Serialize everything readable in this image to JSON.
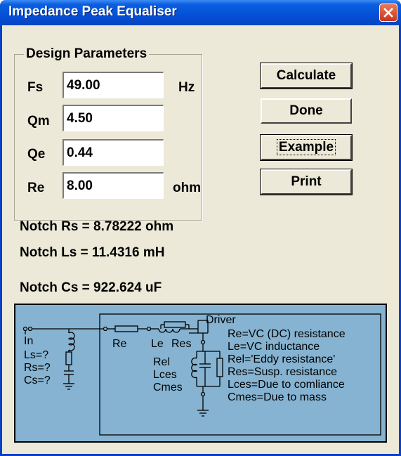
{
  "window": {
    "title": "Impedance Peak Equaliser"
  },
  "design": {
    "legend": "Design Parameters",
    "fs": {
      "label": "Fs",
      "value": "49.00",
      "unit": "Hz"
    },
    "qm": {
      "label": "Qm",
      "value": "4.50"
    },
    "qe": {
      "label": "Qe",
      "value": "0.44"
    },
    "re": {
      "label": "Re",
      "value": "8.00",
      "unit": "ohm"
    }
  },
  "buttons": {
    "calculate": "Calculate",
    "done": "Done",
    "example": "Example",
    "print": "Print"
  },
  "results": {
    "rs": "Notch Rs = 8.78222 ohm",
    "ls": "Notch Ls = 11.4316 mH",
    "cs": "Notch Cs = 922.624 uF"
  },
  "diagram": {
    "in": "In",
    "ls": "Ls=?",
    "rs": "Rs=?",
    "cs": "Cs=?",
    "re": "Re",
    "le": "Le",
    "res": "Res",
    "rel": "Rel",
    "lces": "Lces",
    "cmes": "Cmes",
    "driver": "Driver",
    "legend": [
      "Re=VC (DC) resistance",
      "Le=VC inductance",
      "Rel='Eddy resistance'",
      "Res=Susp. resistance",
      "Lces=Due to comliance",
      "Cmes=Due to mass"
    ],
    "colors": {
      "background": "#85b3d1"
    }
  },
  "colors": {
    "titlebar": "#0550d8",
    "dialog": "#ece9d8",
    "close": "#c5371c"
  },
  "icons": {
    "close": "close-x-icon"
  }
}
